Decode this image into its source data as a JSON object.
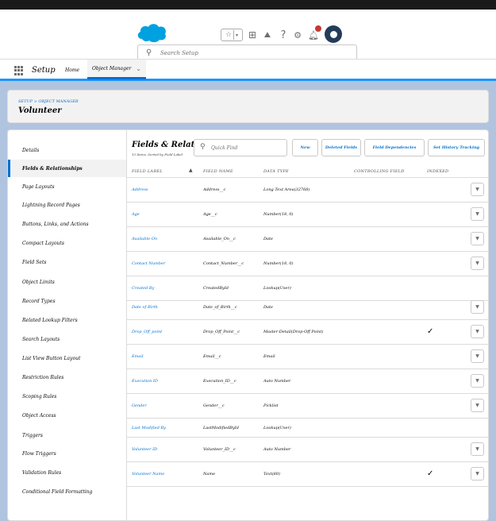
{
  "header": {
    "search_placeholder": "Search Setup",
    "icons": [
      "salesforce-logo",
      "favorites-icon",
      "global-actions-icon",
      "trailhead-icon",
      "help-icon",
      "setup-gear-icon",
      "notifications-bell-icon",
      "user-avatar"
    ]
  },
  "context_bar": {
    "app_name": "Setup",
    "tabs": [
      {
        "label": "Home"
      },
      {
        "label": "Object Manager"
      }
    ]
  },
  "object": {
    "breadcrumb": "SETUP > OBJECT MANAGER",
    "title": "Volunteer"
  },
  "sidebar": {
    "items": [
      {
        "label": "Details"
      },
      {
        "label": "Fields & Relationships"
      },
      {
        "label": "Page Layouts"
      },
      {
        "label": "Lightning Record Pages"
      },
      {
        "label": "Buttons, Links, and Actions"
      },
      {
        "label": "Compact Layouts"
      },
      {
        "label": "Field Sets"
      },
      {
        "label": "Object Limits"
      },
      {
        "label": "Record Types"
      },
      {
        "label": "Related Lookup Filters"
      },
      {
        "label": "Search Layouts"
      },
      {
        "label": "List View Button Layout"
      },
      {
        "label": "Restriction Rules"
      },
      {
        "label": "Scoping Rules"
      },
      {
        "label": "Object Access"
      },
      {
        "label": "Triggers"
      },
      {
        "label": "Flow Triggers"
      },
      {
        "label": "Validation Rules"
      },
      {
        "label": "Conditional Field Formatting"
      }
    ],
    "active": "Fields & Relationships"
  },
  "section": {
    "title": "Fields & Relationships",
    "subtitle": "13 Items, Sorted by Field Label",
    "quick_find_placeholder": "Quick Find",
    "buttons": {
      "new": "New",
      "deleted_fields": "Deleted Fields",
      "field_dependencies": "Field Dependencies",
      "set_history_tracking": "Set History Tracking"
    }
  },
  "table": {
    "columns": {
      "field_label": "FIELD LABEL",
      "field_name": "FIELD NAME",
      "data_type": "DATA TYPE",
      "controlling_field": "CONTROLLING FIELD",
      "indexed": "INDEXED"
    },
    "sort_indicator": "▲",
    "rows": [
      {
        "label": "Address",
        "api": "Address__c",
        "type": "Long Text Area(32768)",
        "indexed": false,
        "menu": true
      },
      {
        "label": "Age",
        "api": "Age__c",
        "type": "Number(18, 0)",
        "indexed": false,
        "menu": true
      },
      {
        "label": "Available On",
        "api": "Available_On__c",
        "type": "Date",
        "indexed": false,
        "menu": true
      },
      {
        "label": "Contact Number",
        "api": "Contact_Number__c",
        "type": "Number(18, 0)",
        "indexed": false,
        "menu": true
      },
      {
        "label": "Created By",
        "api": "CreatedById",
        "type": "Lookup(User)",
        "indexed": false,
        "menu": false
      },
      {
        "label": "Date of Birth",
        "api": "Date_of_Birth__c",
        "type": "Date",
        "indexed": false,
        "menu": true
      },
      {
        "label": "Drop_Off_point",
        "api": "Drop_Off_Point__c",
        "type": "Master-Detail(Drop-Off Point)",
        "indexed": true,
        "menu": true
      },
      {
        "label": "Email",
        "api": "Email__c",
        "type": "Email",
        "indexed": false,
        "menu": true
      },
      {
        "label": "Execution ID",
        "api": "Execution_ID__c",
        "type": "Auto Number",
        "indexed": false,
        "menu": true
      },
      {
        "label": "Gender",
        "api": "Gender__c",
        "type": "Picklist",
        "indexed": false,
        "menu": true
      },
      {
        "label": "Last Modified By",
        "api": "LastModifiedById",
        "type": "Lookup(User)",
        "indexed": false,
        "menu": false
      },
      {
        "label": "Volunteer ID",
        "api": "Volunteer_ID__c",
        "type": "Auto Number",
        "indexed": false,
        "menu": true
      },
      {
        "label": "Volunteer Name",
        "api": "Name",
        "type": "Text(80)",
        "indexed": true,
        "menu": true
      }
    ],
    "check_glyph": "✓",
    "menu_glyph": "▼"
  },
  "colors": {
    "brand_blue": "#0070d2",
    "page_background": "#b0c4df",
    "logo_blue": "#00a1e0"
  }
}
